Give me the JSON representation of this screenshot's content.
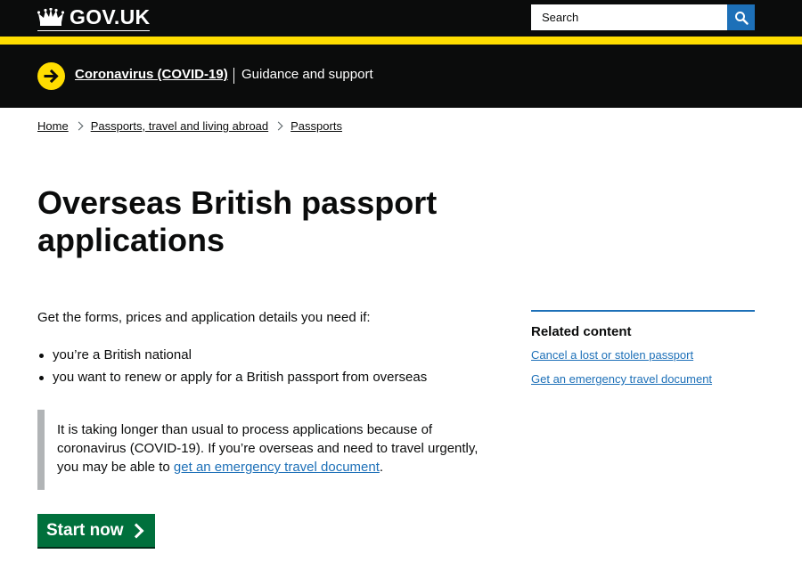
{
  "header": {
    "logo_text": "GOV.UK",
    "search_placeholder": "Search",
    "colors": {
      "header_bg": "#0b0c0c",
      "accent_yellow": "#ffdd00",
      "search_button": "#1d70b8"
    }
  },
  "covid_banner": {
    "link_label": "Coronavirus (COVID-19)",
    "text": "Guidance and support"
  },
  "breadcrumb": [
    {
      "label": "Home"
    },
    {
      "label": "Passports, travel and living abroad"
    },
    {
      "label": "Passports"
    }
  ],
  "page": {
    "title": "Overseas British passport applications",
    "lead": "Get the forms, prices and application details you need if:",
    "bullets": [
      "you’re a British national",
      "you want to renew or apply for a British passport from overseas"
    ],
    "inset": {
      "text_before": "It is taking longer than usual to process applications because of coronavirus (COVID-19). If you’re overseas and need to travel urgently, you may be able to ",
      "link_label": "get an emergency travel document",
      "text_after": "."
    },
    "start_button_label": "Start now"
  },
  "related": {
    "heading": "Related content",
    "links": [
      "Cancel a lost or stolen passport",
      "Get an emergency travel document"
    ]
  },
  "icons": {
    "logo": "crown-icon",
    "search": "search-icon",
    "banner": "arrow-right-circle-icon",
    "breadcrumb_separator": "chevron-right-icon",
    "start": "chevron-right-icon"
  },
  "colors": {
    "link": "#1d70b8",
    "start_button": "#00703c",
    "inset_border": "#b1b4b6",
    "text": "#0b0c0c"
  }
}
